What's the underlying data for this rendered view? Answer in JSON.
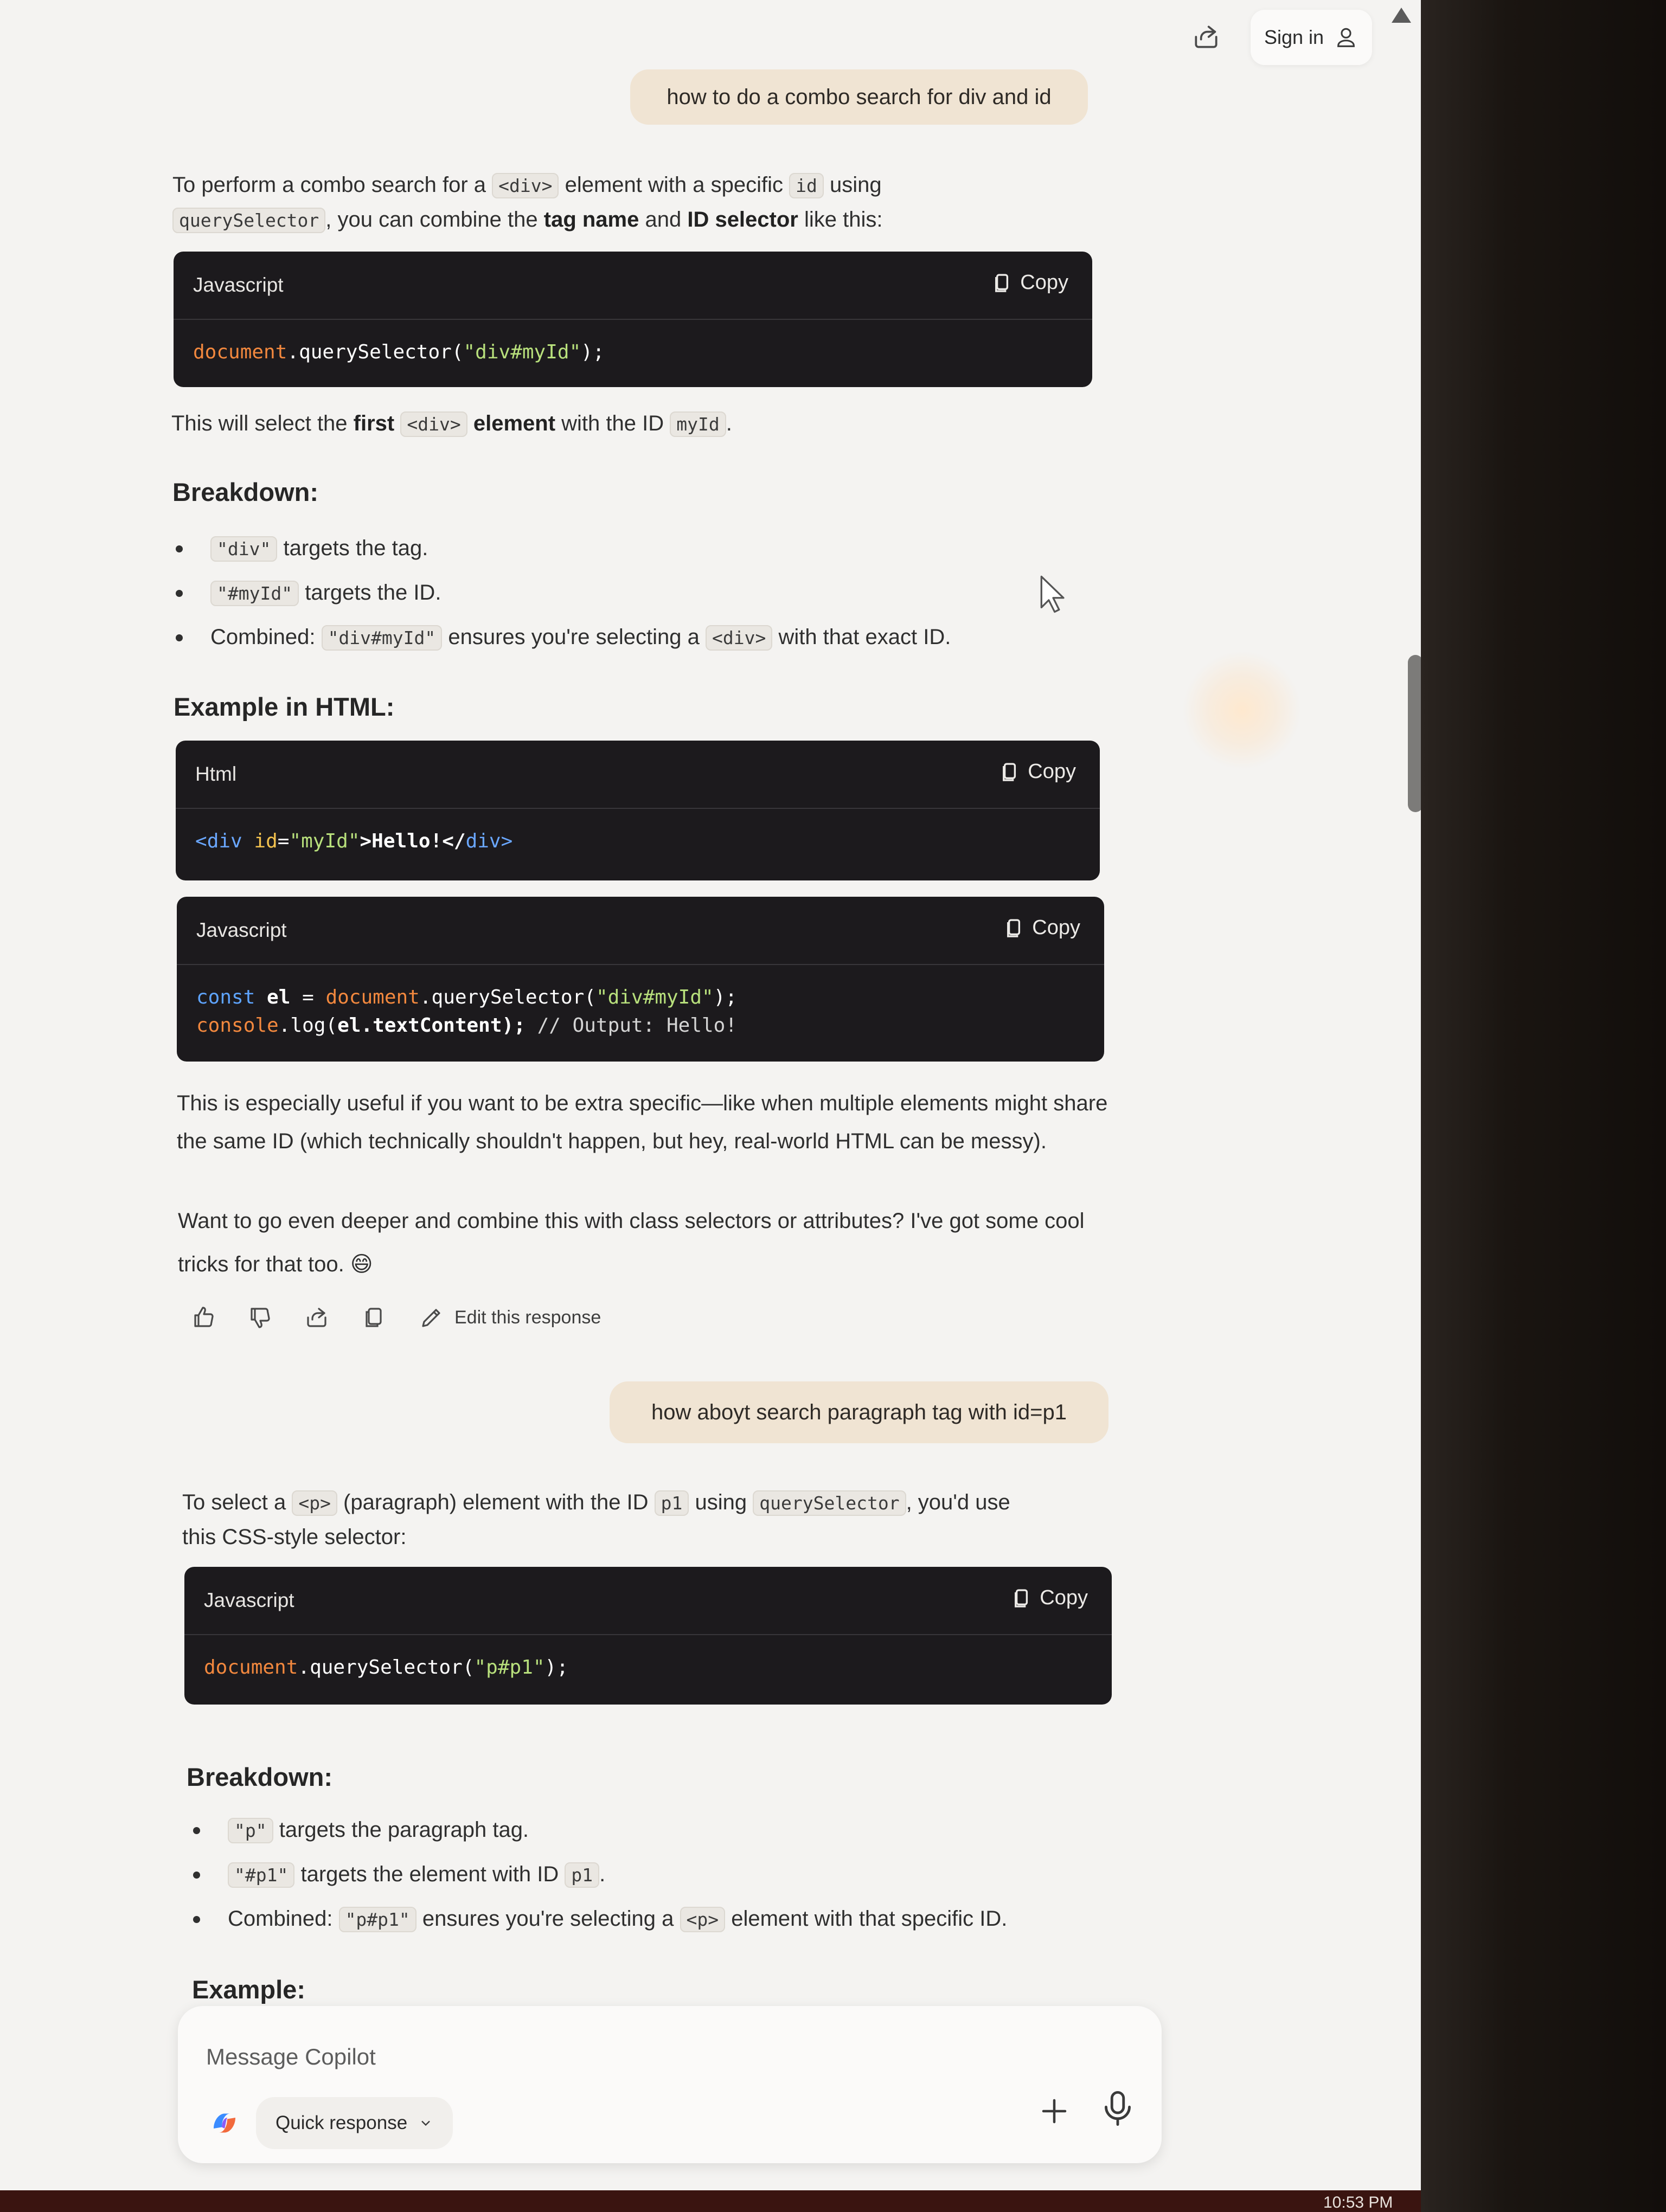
{
  "header": {
    "sign_in": "Sign in"
  },
  "conversation": {
    "user_message_1": "how to do a combo search for div and id",
    "answer_1": {
      "intro": {
        "t1": "To perform a combo search for a ",
        "c1": "<div>",
        "t2": " element with a specific ",
        "c2": "id",
        "t3": " using",
        "c3": "querySelector",
        "t4": ", you can combine the ",
        "b1": "tag name",
        "t5": " and ",
        "b2": "ID selector",
        "t6": " like this:"
      },
      "code1": {
        "lang": "Javascript",
        "copy": "Copy"
      },
      "select_note": {
        "t1": "This will select the ",
        "b1": "first",
        "c1": "<div>",
        "b2": "element",
        "t2": " with the ID ",
        "c2": "myId",
        "t3": "."
      },
      "breakdown_title": "Breakdown:",
      "breakdown": [
        {
          "code": "\"div\"",
          "text": "targets the tag."
        },
        {
          "code": "\"#myId\"",
          "text": "targets the ID."
        },
        {
          "prefix": "Combined:",
          "code": "\"div#myId\"",
          "text": "ensures you're selecting a",
          "code2": "<div>",
          "text2": "with that exact ID."
        }
      ],
      "example_title": "Example in HTML:",
      "code2": {
        "lang": "Html",
        "copy": "Copy"
      },
      "code3": {
        "lang": "Javascript",
        "copy": "Copy"
      },
      "outro_1": "This is especially useful if you want to be extra specific—like when multiple elements might share the same ID (which technically shouldn't happen, but hey, real-world HTML can be messy).",
      "outro_2": "Want to go even deeper and combine this with class selectors or attributes? I've got some cool tricks for that too.",
      "emoji": "😄",
      "edit_response": "Edit this response"
    },
    "user_message_2": "how aboyt search paragraph tag with id=p1",
    "answer_2": {
      "intro": {
        "t1": "To select a ",
        "c1": "<p>",
        "t2": " (paragraph) element with the ID ",
        "c2": "p1",
        "t3": " using ",
        "c3": "querySelector",
        "t4": ", you'd use",
        "t5": "this CSS-style selector:"
      },
      "code1": {
        "lang": "Javascript",
        "copy": "Copy"
      },
      "breakdown_title": "Breakdown:",
      "breakdown": [
        {
          "code": "\"p\"",
          "text": "targets the paragraph tag."
        },
        {
          "code": "\"#p1\"",
          "text": "targets the element with ID",
          "code2": "p1",
          "text2": "."
        },
        {
          "prefix": "Combined:",
          "code": "\"p#p1\"",
          "text": "ensures you're selecting a",
          "code2": "<p>",
          "text2": "element with that specific ID."
        }
      ],
      "example_title": "Example:"
    }
  },
  "code_tokens": {
    "doc": "document",
    "qs": ".querySelector(",
    "s_divmyid": "\"div#myId\"",
    "close": ");",
    "lt": "<",
    "div": "div",
    "id_attr": "id",
    "eq": "=",
    "s_myid": "\"myId\"",
    "hello_mid": ">Hello!</",
    "gt": ">",
    "const": "const",
    "el": " el ",
    "console": "console",
    "log": ".log(",
    "el_tc": "el.textContent);",
    "comment": "// Output: Hello!",
    "s_pp1": "\"p#p1\""
  },
  "composer": {
    "placeholder": "Message Copilot",
    "quick_response": "Quick response"
  },
  "taskbar": {
    "clock": "10:53 PM"
  }
}
